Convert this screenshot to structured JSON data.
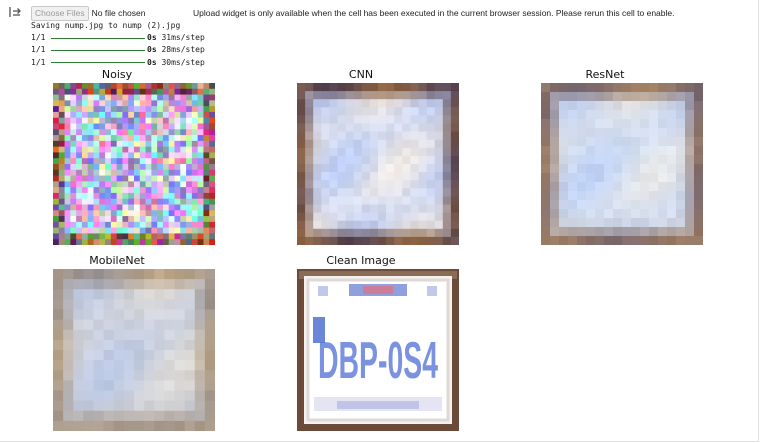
{
  "output_icon": "output-redirect-icon",
  "upload": {
    "choose_label": "Choose Files",
    "no_file_label": "No file chosen",
    "warning": "Upload widget is only available when the cell has been executed in the current browser session. Please rerun this cell to enable."
  },
  "console": {
    "saving_line": "Saving nump.jpg to nump (2).jpg",
    "steps": [
      {
        "label": "1/1",
        "time": "0s",
        "rate": "31ms/step"
      },
      {
        "label": "1/1",
        "time": "0s",
        "rate": "28ms/step"
      },
      {
        "label": "1/1",
        "time": "0s",
        "rate": "30ms/step"
      }
    ]
  },
  "panels": [
    {
      "title": "Noisy",
      "style": "noisy"
    },
    {
      "title": "CNN",
      "style": "cnn"
    },
    {
      "title": "ResNet",
      "style": "resnet"
    },
    {
      "title": "MobileNet",
      "style": "mobilenet"
    },
    {
      "title": "Clean Image",
      "style": "clean"
    }
  ],
  "plate_text": "DBP-0S4"
}
